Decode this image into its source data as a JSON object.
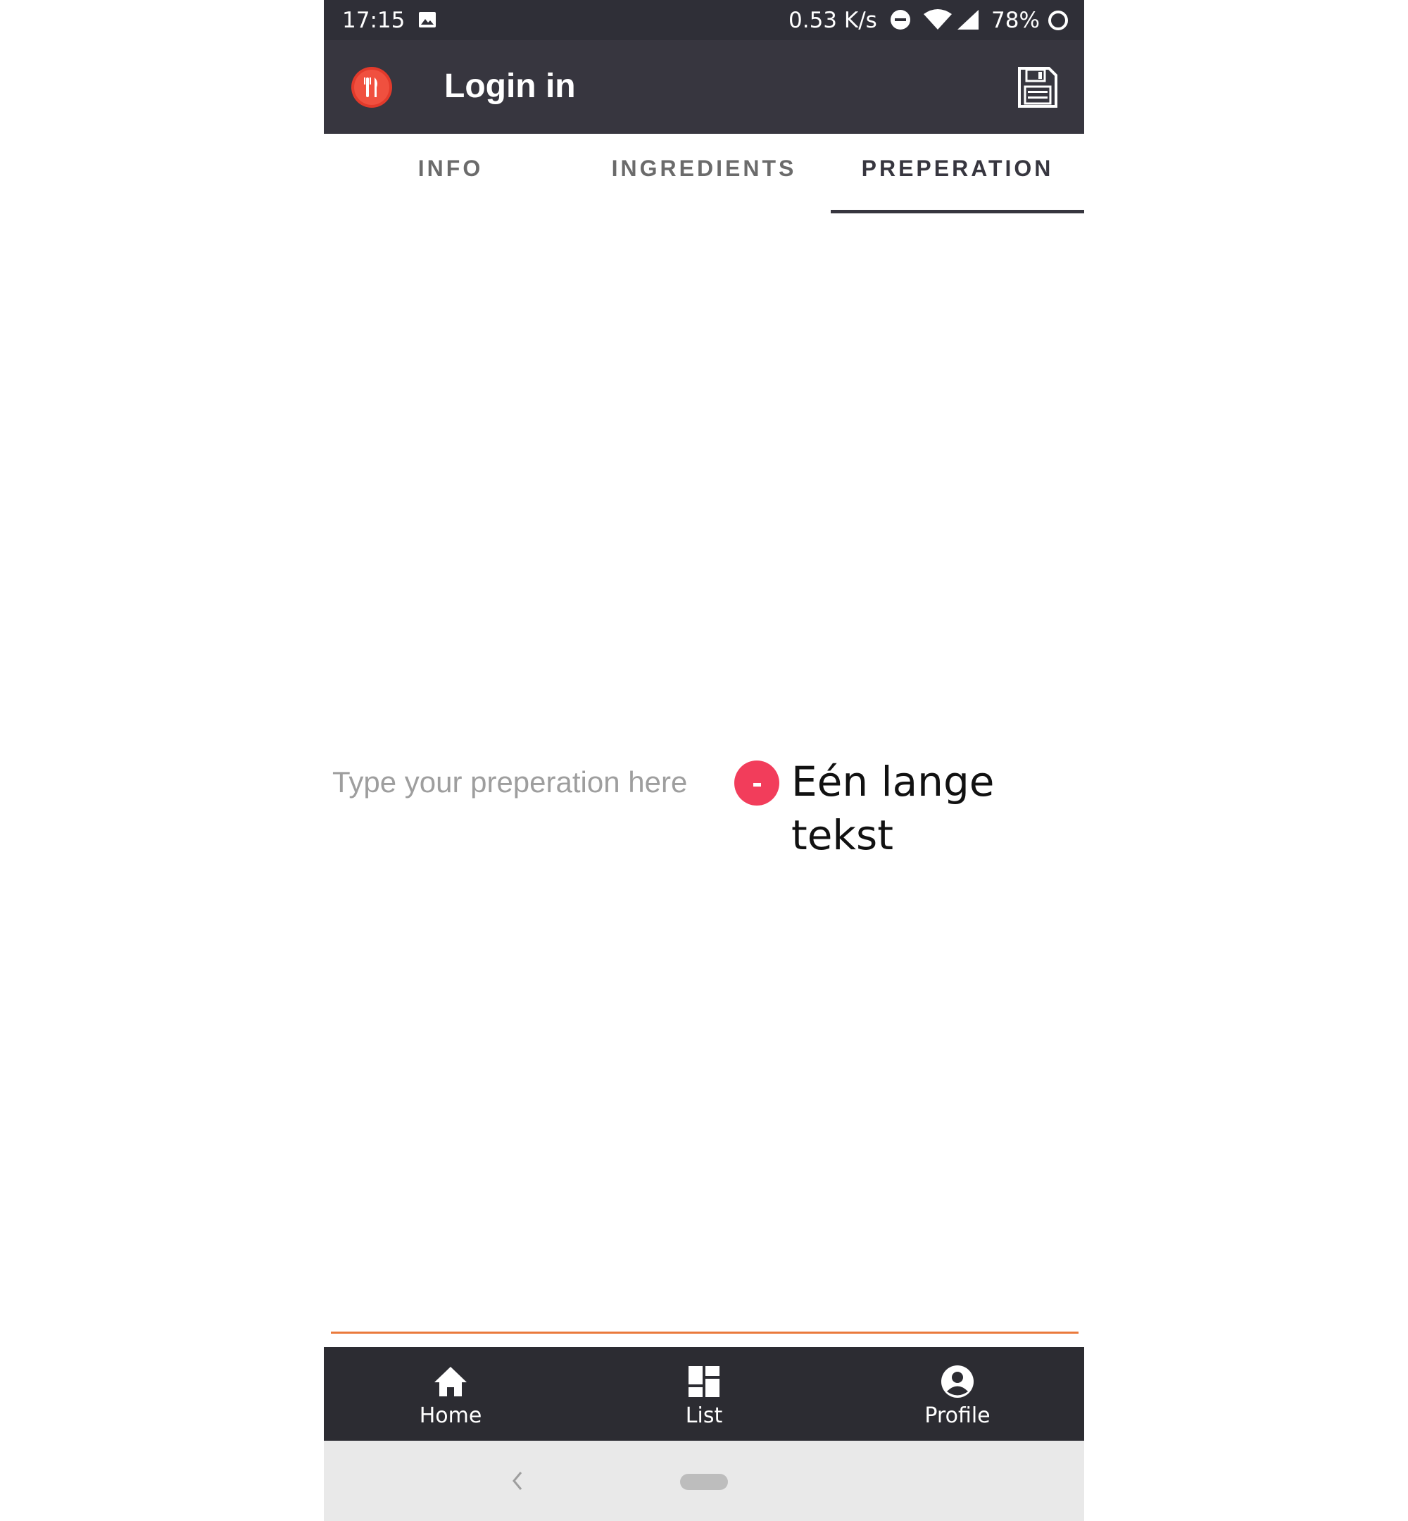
{
  "status_bar": {
    "time": "17:15",
    "speed": "0.53 K/s",
    "battery": "78%",
    "icons": [
      "gallery-icon",
      "dnd-icon",
      "wifi-icon",
      "signal-icon",
      "battery-icon"
    ]
  },
  "app_bar": {
    "title": "Login in",
    "logo_icon": "fork-knife-icon",
    "action_icon": "save-icon"
  },
  "tabs": [
    {
      "label": "INFO",
      "active": false
    },
    {
      "label": "INGREDIENTS",
      "active": false
    },
    {
      "label": "PREPERATION",
      "active": true
    }
  ],
  "preparation": {
    "input_placeholder": "Type your preperation here",
    "input_value": "",
    "steps": [
      {
        "text": "Eén lange tekst"
      }
    ]
  },
  "bottom_nav": [
    {
      "label": "Home",
      "icon": "home-icon"
    },
    {
      "label": "List",
      "icon": "dashboard-icon"
    },
    {
      "label": "Profile",
      "icon": "account-circle-icon"
    }
  ],
  "colors": {
    "status_bar": "#2f2f37",
    "app_bar": "#37363f",
    "accent_remove": "#f23d5b",
    "divider": "#ea7a3c",
    "bottom_nav": "#2c2c32",
    "system_nav": "#e9e9e9"
  }
}
